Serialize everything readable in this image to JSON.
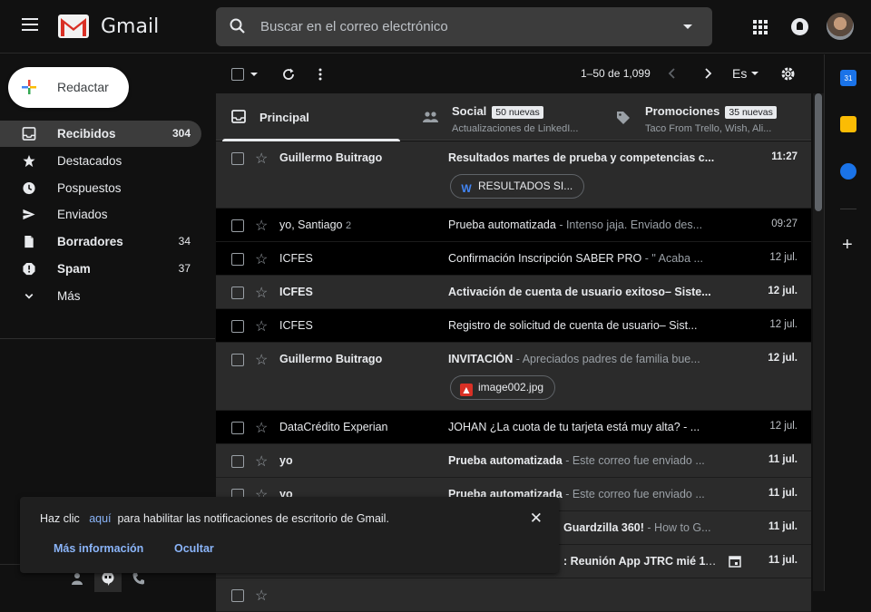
{
  "header": {
    "brand": "Gmail",
    "search_placeholder": "Buscar en el correo electrónico"
  },
  "compose_label": "Redactar",
  "nav": [
    {
      "label": "Recibidos",
      "count": "304",
      "icon": "inbox-icon",
      "bold": true,
      "active": true
    },
    {
      "label": "Destacados",
      "count": "",
      "icon": "star-icon"
    },
    {
      "label": "Pospuestos",
      "count": "",
      "icon": "clock-icon"
    },
    {
      "label": "Enviados",
      "count": "",
      "icon": "send-icon"
    },
    {
      "label": "Borradores",
      "count": "34",
      "icon": "draft-icon",
      "bold": true
    },
    {
      "label": "Spam",
      "count": "37",
      "icon": "spam-icon",
      "bold": true
    },
    {
      "label": "Más",
      "count": "",
      "icon": "chevron-down-icon"
    }
  ],
  "toolbar": {
    "pager": "1–50 de 1,099",
    "lang": "Es"
  },
  "tabs": {
    "principal": "Principal",
    "social": {
      "label": "Social",
      "badge": "50 nuevas",
      "sub": "Actualizaciones de LinkedI..."
    },
    "promos": {
      "label": "Promociones",
      "badge": "35 nuevas",
      "sub": "Taco From Trello, Wish, Ali..."
    }
  },
  "emails": [
    {
      "sender": "Guillermo Buitrago",
      "count": "",
      "subject": "Resultados martes de prueba y competencias c...",
      "snippet": "",
      "date": "11:27",
      "unread": true,
      "attachment": "RESULTADOS SI..."
    },
    {
      "sender": "yo, Santiago",
      "count": "2",
      "subject": "Prueba automatizada",
      "snippet": " - Intenso jaja. Enviado des...",
      "date": "09:27",
      "unread": false
    },
    {
      "sender": "ICFES",
      "count": "",
      "subject": "Confirmación Inscripción SABER PRO",
      "snippet": " - \" Acaba ...",
      "date": "12 jul.",
      "unread": false
    },
    {
      "sender": "ICFES",
      "count": "",
      "subject": "Activación de cuenta de usuario exitoso– Siste...",
      "snippet": "",
      "date": "12 jul.",
      "unread": true
    },
    {
      "sender": "ICFES",
      "count": "",
      "subject": "Registro de solicitud de cuenta de usuario– Sist...",
      "snippet": "",
      "date": "12 jul.",
      "unread": false
    },
    {
      "sender": "Guillermo Buitrago",
      "count": "",
      "subject": "INVITACIÓN",
      "snippet": " - Apreciados padres de familia bue...",
      "date": "12 jul.",
      "unread": true,
      "attachment": "image002.jpg"
    },
    {
      "sender": "DataCrédito Experian",
      "count": "",
      "subject": "JOHAN ¿La cuota de tu tarjeta está muy alta? - ...",
      "snippet": "",
      "date": "12 jul.",
      "unread": false
    },
    {
      "sender": "yo",
      "count": "",
      "subject": "Prueba automatizada",
      "snippet": " - Este correo fue enviado ...",
      "date": "11 jul.",
      "unread": true
    },
    {
      "sender": "yo",
      "count": "",
      "subject": "Prueba automatizada",
      "snippet": " - Este correo fue enviado ...",
      "date": "11 jul.",
      "unread": true
    },
    {
      "sender": "",
      "count": "",
      "subject": "Guardzilla 360!",
      "snippet": " - How to G...",
      "date": "11 jul.",
      "unread": true
    },
    {
      "sender": "",
      "count": "",
      "subject": ": Reunión App JTRC mié 11...",
      "snippet": "",
      "date": "11 jul.",
      "unread": true
    },
    {
      "sender": "",
      "count": "",
      "subject": "",
      "snippet": "",
      "date": "",
      "unread": true
    }
  ],
  "toast": {
    "pre": "Haz clic",
    "link": "aquí",
    "post": "para habilitar las notificaciones de escritorio de Gmail.",
    "more": "Más información",
    "hide": "Ocultar"
  }
}
